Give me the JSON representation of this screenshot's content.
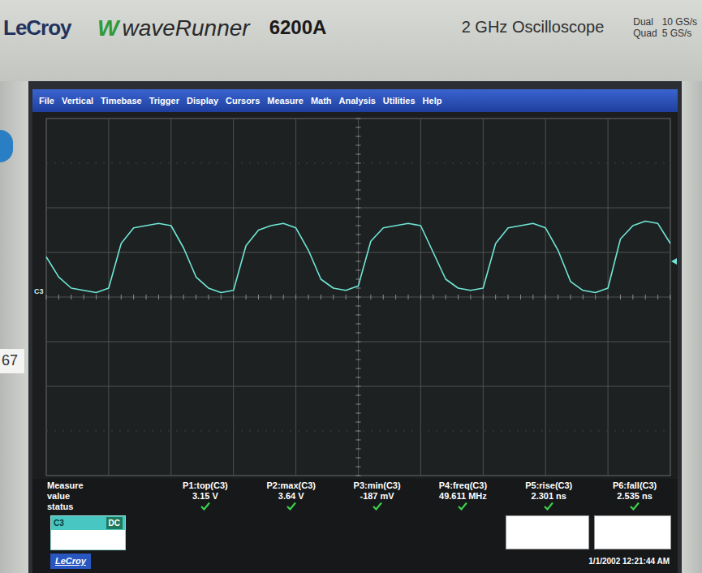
{
  "bezel": {
    "brand": "LeCroy",
    "logo_mark": "W",
    "series_name": "waveRunner",
    "model": "6200A",
    "bandwidth": "2 GHz Oscilloscope",
    "rates": [
      {
        "mode": "Dual",
        "rate": "10 GS/s"
      },
      {
        "mode": "Quad",
        "rate": "5 GS/s"
      }
    ],
    "side_label": "67"
  },
  "menu": [
    "File",
    "Vertical",
    "Timebase",
    "Trigger",
    "Display",
    "Cursors",
    "Measure",
    "Math",
    "Analysis",
    "Utilities",
    "Help"
  ],
  "chart": {
    "trace_label": "C3",
    "series": [
      {
        "values": [
          1.8,
          0.9,
          0.4,
          0.3,
          0.2,
          0.4,
          2.4,
          3.1,
          3.2,
          3.3,
          3.2,
          2.2,
          0.9,
          0.4,
          0.2,
          0.3,
          2.3,
          3.0,
          3.2,
          3.3,
          3.1,
          2.1,
          0.8,
          0.4,
          0.3,
          0.5,
          2.5,
          3.1,
          3.2,
          3.3,
          3.2,
          2.0,
          0.8,
          0.4,
          0.3,
          0.4,
          2.4,
          3.1,
          3.2,
          3.3,
          3.1,
          2.1,
          0.7,
          0.3,
          0.2,
          0.4,
          2.6,
          3.2,
          3.4,
          3.3,
          2.4
        ]
      }
    ]
  },
  "measure": {
    "headers": [
      "Measure",
      "value",
      "status"
    ],
    "items": [
      {
        "label": "P1:top(C3)",
        "value": "3.15 V",
        "ok": true
      },
      {
        "label": "P2:max(C3)",
        "value": "3.64 V",
        "ok": true
      },
      {
        "label": "P3:min(C3)",
        "value": "-187 mV",
        "ok": true
      },
      {
        "label": "P4:freq(C3)",
        "value": "49.611 MHz",
        "ok": true
      },
      {
        "label": "P5:rise(C3)",
        "value": "2.301 ns",
        "ok": true
      },
      {
        "label": "P6:fall(C3)",
        "value": "2.535 ns",
        "ok": true
      }
    ]
  },
  "channel_box": {
    "label": "C3",
    "coupling": "DC"
  },
  "footer": {
    "logo": "LeCroy",
    "timestamp": "1/1/2002 12:21:44 AM"
  }
}
